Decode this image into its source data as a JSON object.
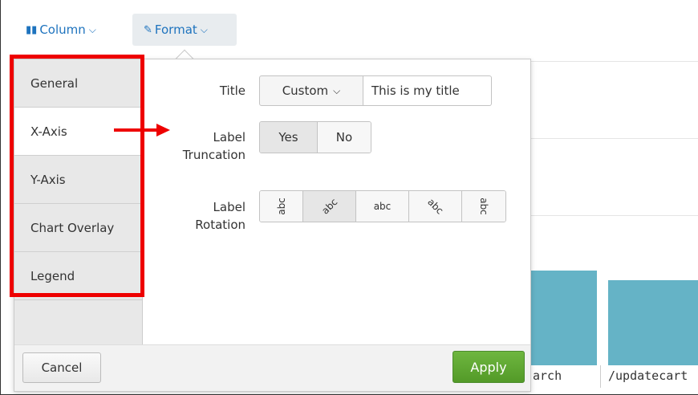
{
  "toolbar": {
    "column_label": "Column",
    "format_label": "Format"
  },
  "nav": {
    "items": [
      "General",
      "X-Axis",
      "Y-Axis",
      "Chart Overlay",
      "Legend"
    ]
  },
  "fields": {
    "title_label": "Title",
    "title_mode": "Custom",
    "title_value": "This is my title",
    "truncation_label_1": "Label",
    "truncation_label_2": "Truncation",
    "truncation_options": [
      "Yes",
      "No"
    ],
    "rotation_label_1": "Label",
    "rotation_label_2": "Rotation",
    "rotation_options": [
      "abc",
      "abc",
      "abc",
      "abc",
      "abc"
    ]
  },
  "footer": {
    "cancel_label": "Cancel",
    "apply_label": "Apply"
  },
  "chart_bg": {
    "x_labels": [
      "arch",
      "/updatecart"
    ]
  },
  "colors": {
    "apply_green": "#5aa32f",
    "annotation_red": "#ee0000",
    "bar_teal": "#65b3c6",
    "link_blue": "#1e73be"
  }
}
